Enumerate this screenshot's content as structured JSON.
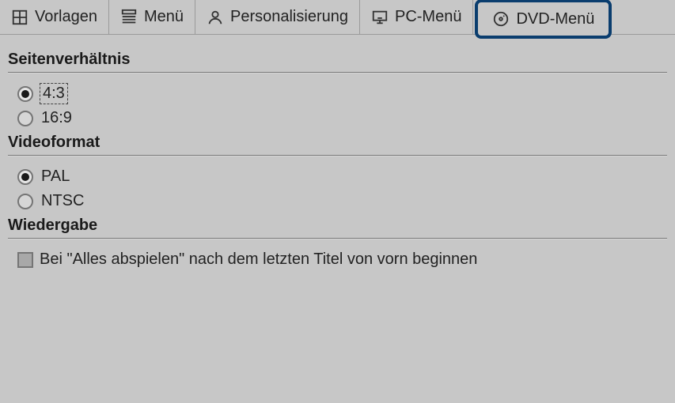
{
  "tabs": {
    "templates": "Vorlagen",
    "menu": "Menü",
    "personalisation": "Personalisierung",
    "pcmenu": "PC-Menü",
    "dvdmenu": "DVD-Menü"
  },
  "sections": {
    "aspect": {
      "title": "Seitenverhältnis",
      "opt_43": "4:3",
      "opt_169": "16:9",
      "selected": "4:3"
    },
    "videoformat": {
      "title": "Videoformat",
      "opt_pal": "PAL",
      "opt_ntsc": "NTSC",
      "selected": "PAL"
    },
    "playback": {
      "title": "Wiedergabe",
      "loop_label": "Bei \"Alles abspielen\" nach dem letzten Titel von vorn beginnen",
      "loop_checked": false
    }
  }
}
